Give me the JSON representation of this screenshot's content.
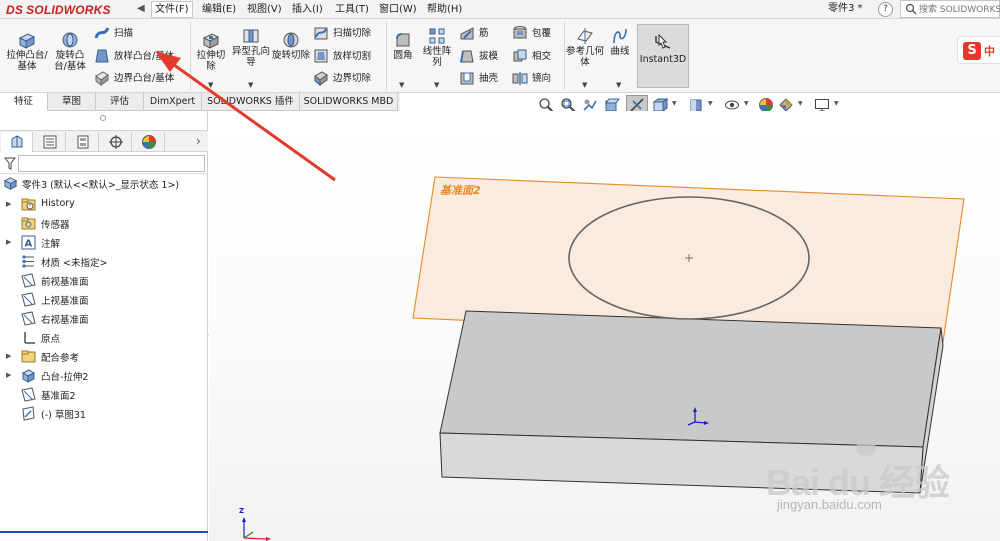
{
  "app": {
    "logo_ds": "DS",
    "logo_text": "SOLIDWORKS",
    "document_title": "零件3 *",
    "help_symbol": "?"
  },
  "menu": [
    {
      "label": "文件(F)"
    },
    {
      "label": "编辑(E)"
    },
    {
      "label": "视图(V)"
    },
    {
      "label": "插入(I)"
    },
    {
      "label": "工具(T)"
    },
    {
      "label": "窗口(W)"
    },
    {
      "label": "帮助(H)"
    }
  ],
  "search": {
    "placeholder": "搜索 SOLIDWORKS 帮助"
  },
  "ribbon": {
    "extrude_boss": "拉伸凸台/基体",
    "revolve_boss": "旋转凸台/基体",
    "sweep": "扫描",
    "loft_boss": "放样凸台/基体",
    "boundary_boss": "边界凸台/基体",
    "extrude_cut": "拉伸切除",
    "hole_wizard": "异型孔向导",
    "revolve_cut": "旋转切除",
    "swept_cut": "扫描切除",
    "lofted_cut": "放样切割",
    "boundary_cut": "边界切除",
    "fillet": "圆角",
    "linear_pattern": "线性阵列",
    "rib": "筋",
    "draft": "拔模",
    "shell": "抽壳",
    "wrap": "包覆",
    "intersect": "相交",
    "mirror": "镜向",
    "reference_geometry": "参考几何体",
    "curves": "曲线",
    "instant3d": "Instant3D"
  },
  "ime": {
    "logo": "S",
    "text": "中"
  },
  "tabs": [
    {
      "label": "特征",
      "active": true
    },
    {
      "label": "草图",
      "active": false
    },
    {
      "label": "评估",
      "active": false
    },
    {
      "label": "DimXpert",
      "active": false
    },
    {
      "label": "SOLIDWORKS 插件",
      "active": false
    },
    {
      "label": "SOLIDWORKS MBD",
      "active": false
    }
  ],
  "feature_manager": {
    "root_label": "零件3 (默认<<默认>_显示状态 1>)",
    "items": [
      {
        "label": "History",
        "icon": "history-folder-icon",
        "expandable": true
      },
      {
        "label": "传感器",
        "icon": "sensor-folder-icon",
        "expandable": false
      },
      {
        "label": "注解",
        "icon": "annotation-icon",
        "expandable": true
      },
      {
        "label": "材质 <未指定>",
        "icon": "material-icon",
        "expandable": false
      },
      {
        "label": "前视基准面",
        "icon": "plane-icon",
        "expandable": false
      },
      {
        "label": "上视基准面",
        "icon": "plane-icon",
        "expandable": false
      },
      {
        "label": "右视基准面",
        "icon": "plane-icon",
        "expandable": false
      },
      {
        "label": "原点",
        "icon": "origin-icon",
        "expandable": false
      },
      {
        "label": "配合参考",
        "icon": "mate-reference-icon",
        "expandable": true
      },
      {
        "label": "凸台-拉伸2",
        "icon": "extrude-feature-icon",
        "expandable": true
      },
      {
        "label": "基准面2",
        "icon": "plane-icon",
        "expandable": false
      },
      {
        "label": "(-) 草图31",
        "icon": "sketch-icon",
        "expandable": false
      }
    ]
  },
  "viewport": {
    "plane_label": "基准面2",
    "triad_z": "Z",
    "watermark_brand": "Bai du 经验",
    "watermark_url": "jingyan.baidu.com"
  },
  "colors": {
    "plane_edge": "#e8892a",
    "plane_fill": "#f7dcc4",
    "box_top": "#c9c9c9",
    "box_front": "#d9d9d9",
    "annotation_arrow": "#e23b2e",
    "logo_red": "#c8201f"
  }
}
